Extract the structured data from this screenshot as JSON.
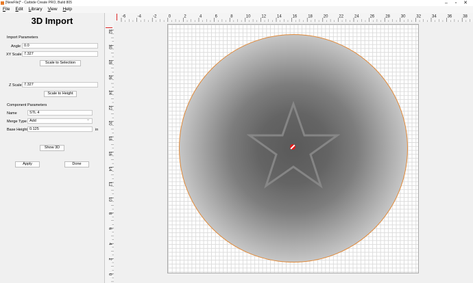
{
  "window": {
    "title": "[NewFile]* - Carbide Create PRO, Build 805",
    "minimize_icon": "minimize-icon",
    "maximize_icon": "maximize-icon",
    "close_icon": "close-icon"
  },
  "menu": [
    "File",
    "Edit",
    "Library",
    "View",
    "Help"
  ],
  "panel": {
    "title": "3D Import",
    "import_section": "Import Parameters",
    "angle_label": "Angle",
    "angle_value": "0.0",
    "xy_scale_label": "XY Scale",
    "xy_scale_value": "7.327",
    "scale_to_selection": "Scale to Selection",
    "z_scale_label": "Z Scale",
    "z_scale_value": "7.327",
    "scale_to_height": "Scale to Height",
    "component_section": "Component Parameters",
    "name_label": "Name",
    "name_value": "STL 4",
    "merge_label": "Merge Type",
    "merge_value": "Add",
    "base_label": "Base Height",
    "base_value": "0.125",
    "base_unit": "in",
    "show3d": "Show 3D",
    "apply": "Apply",
    "done": "Done"
  },
  "rulers": {
    "horizontal": [
      "-6",
      "-4",
      "-2",
      "0",
      "2",
      "4",
      "6",
      "8",
      "10",
      "12",
      "14",
      "16",
      "18",
      "20",
      "22",
      "24",
      "26",
      "28",
      "30",
      "32",
      "34",
      "36",
      "38"
    ],
    "vertical": [
      "32",
      "30",
      "28",
      "26",
      "24",
      "22",
      "20",
      "18",
      "16",
      "14",
      "12",
      "10",
      "8",
      "6",
      "4",
      "2",
      "0"
    ]
  },
  "colors": {
    "toolpath_outline": "#e08a3a",
    "origin_marker": "#e01a1a"
  }
}
